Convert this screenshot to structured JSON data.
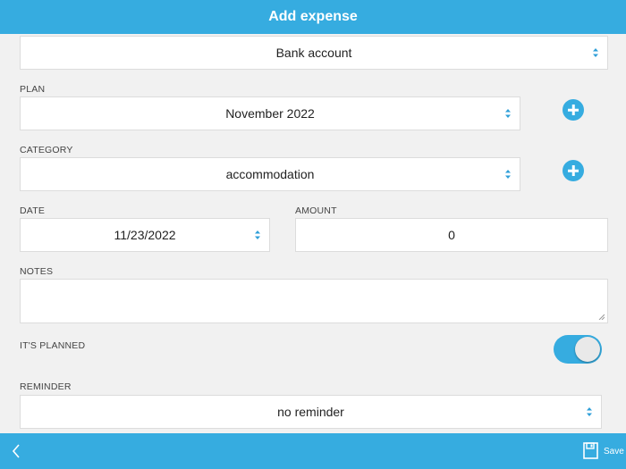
{
  "colors": {
    "accent": "#36ace0"
  },
  "header": {
    "title": "Add expense"
  },
  "account": {
    "value": "Bank account",
    "icon": "chevron-updown-icon"
  },
  "plan": {
    "label": "PLAN",
    "value": "November 2022",
    "add_icon": "plus-circle-icon"
  },
  "category": {
    "label": "CATEGORY",
    "value": "accommodation",
    "add_icon": "plus-circle-icon"
  },
  "date": {
    "label": "DATE",
    "value": "11/23/2022"
  },
  "amount": {
    "label": "AMOUNT",
    "value": "0"
  },
  "notes": {
    "label": "NOTES",
    "value": ""
  },
  "planned": {
    "label": "IT'S PLANNED",
    "on": true
  },
  "reminder": {
    "label": "REMINDER",
    "value": "no reminder"
  },
  "footer": {
    "back_icon": "chevron-left-icon",
    "save_icon": "floppy-disk-icon",
    "save_label": "Save"
  }
}
